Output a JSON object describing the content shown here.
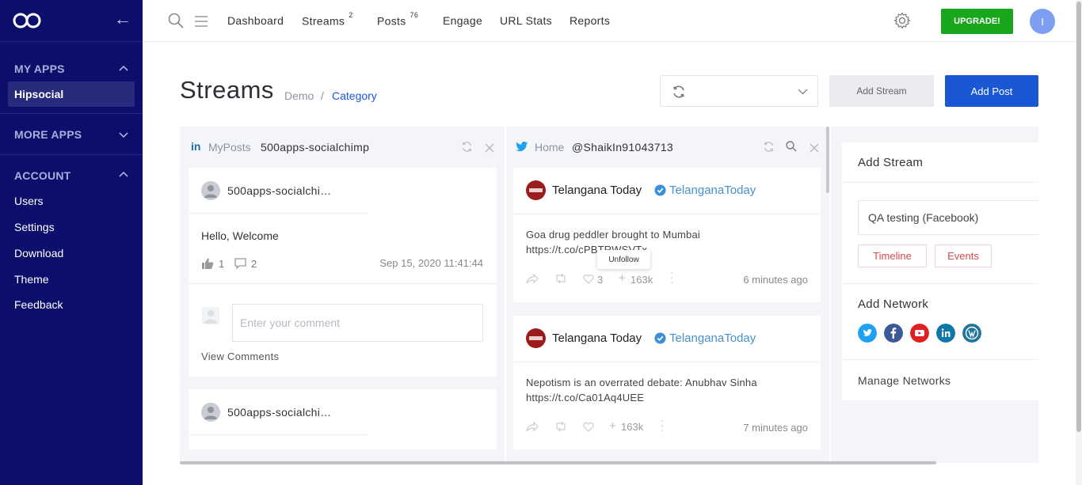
{
  "sidebar": {
    "sections": {
      "my_apps": "MY APPS",
      "more_apps": "MORE APPS",
      "account": "ACCOUNT"
    },
    "active_app": "Hipsocial",
    "account_items": [
      "Users",
      "Settings",
      "Download",
      "Theme",
      "Feedback"
    ]
  },
  "topnav": {
    "items": [
      {
        "label": "Dashboard"
      },
      {
        "label": "Streams",
        "badge": "2"
      },
      {
        "label": "Posts",
        "badge": "76"
      },
      {
        "label": "Engage"
      },
      {
        "label": "URL Stats"
      },
      {
        "label": "Reports"
      }
    ],
    "upgrade_label": "UPGRADE!",
    "avatar_initial": "I"
  },
  "header": {
    "title": "Streams",
    "breadcrumb": [
      "Demo",
      "/",
      "Category"
    ],
    "select_value": "",
    "add_stream_label": "Add Stream",
    "add_post_label": "Add Post"
  },
  "column1": {
    "type_label": "MyPosts",
    "account": "500apps-socialchimp",
    "posts": [
      {
        "author": "500apps-socialchi…",
        "text": "Hello, Welcome",
        "likes": "1",
        "comments": "2",
        "date": "Sep 15, 2020 11:41:44",
        "comment_placeholder": "Enter your comment",
        "view_comments": "View Comments"
      },
      {
        "author": "500apps-socialchi…"
      }
    ]
  },
  "column2": {
    "type_label": "Home",
    "account": "@ShaikIn91043713",
    "tooltip": "Unfollow",
    "tweets": [
      {
        "name": "Telangana Today",
        "handle": "TelanganaToday",
        "text_line1": "Goa drug peddler brought to Mumbai",
        "text_line2": "https://t.co/cPBTRWSVTx",
        "likes": "3",
        "followers": "163k",
        "time": "6 minutes ago"
      },
      {
        "name": "Telangana Today",
        "handle": "TelanganaToday",
        "text_line1": "Nepotism is an overrated debate: Anubhav Sinha",
        "text_line2": "https://t.co/Ca01Aq4UEE",
        "likes": "",
        "followers": "163k",
        "time": "7 minutes ago"
      }
    ]
  },
  "add_stream_panel": {
    "title": "Add Stream",
    "account_value": "QA testing (Facebook)",
    "tabs": [
      "Timeline",
      "Events"
    ],
    "add_network_title": "Add Network",
    "networks": [
      "twitter-icon",
      "facebook-icon",
      "youtube-icon",
      "linkedin-icon",
      "wordpress-icon"
    ],
    "manage_label": "Manage Networks"
  },
  "colors": {
    "sidebar_bg": "#0b0f6b",
    "primary": "#1a57d5",
    "upgrade": "#18a61d",
    "danger": "#d94a4a"
  }
}
